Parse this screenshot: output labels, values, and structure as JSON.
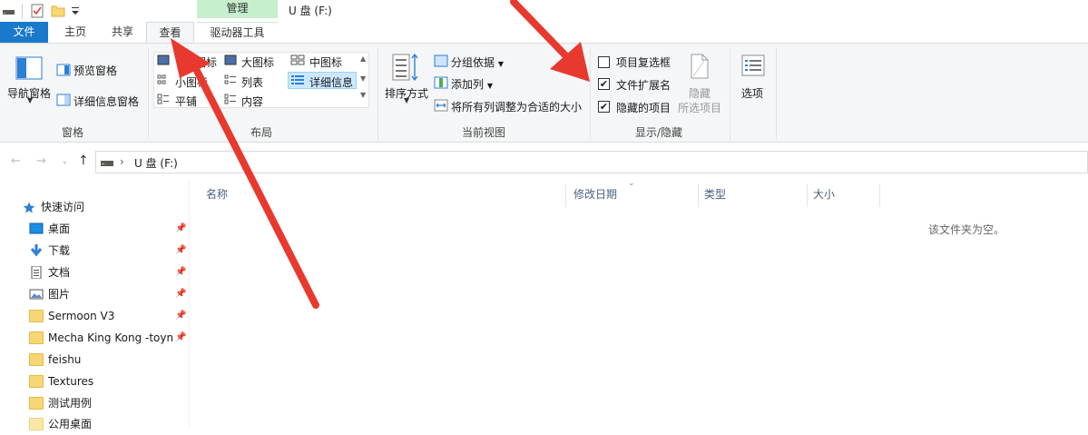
{
  "window": {
    "title": "U 盘 (F:)"
  },
  "context_tab": {
    "header": "管理",
    "tab": "驱动器工具"
  },
  "tabs": {
    "file": "文件",
    "home": "主页",
    "share": "共享",
    "view": "查看"
  },
  "ribbon": {
    "pane": {
      "nav_pane": "导航窗格",
      "preview_pane": "预览窗格",
      "details_pane": "详细信息窗格",
      "group": "窗格"
    },
    "layout": {
      "items": [
        "图标",
        "大图标",
        "中图标",
        "小图标",
        "列表",
        "详细信息",
        "平铺",
        "内容"
      ],
      "group": "布局"
    },
    "current_view": {
      "sort_by": "排序方式",
      "group_by": "分组依据",
      "add_column": "添加列",
      "size_all_columns": "将所有列调整为合适的大小",
      "group": "当前视图"
    },
    "show_hide": {
      "item_checkboxes": "项目复选框",
      "file_extensions": "文件扩展名",
      "hidden_items": "隐藏的项目",
      "item_checkboxes_checked": false,
      "file_extensions_checked": true,
      "hidden_items_checked": true,
      "hide_selected_1": "隐藏",
      "hide_selected_2": "所选项目",
      "group": "显示/隐藏"
    },
    "options": "选项"
  },
  "address": {
    "path_sep": "›",
    "location": "U 盘 (F:)"
  },
  "nav": {
    "quick_access": "快速访问",
    "items": [
      {
        "label": "桌面",
        "icon": "desktop-icon",
        "pinned": true
      },
      {
        "label": "下载",
        "icon": "download-icon",
        "pinned": true
      },
      {
        "label": "文档",
        "icon": "document-icon",
        "pinned": true
      },
      {
        "label": "图片",
        "icon": "pictures-icon",
        "pinned": true
      },
      {
        "label": "Sermoon V3",
        "icon": "folder-icon",
        "pinned": true
      },
      {
        "label": "Mecha King Kong -toyn",
        "icon": "folder-icon",
        "pinned": true
      },
      {
        "label": "feishu",
        "icon": "folder-icon",
        "pinned": false
      },
      {
        "label": "Textures",
        "icon": "folder-icon",
        "pinned": false
      },
      {
        "label": "测试用例",
        "icon": "folder-icon",
        "pinned": false
      },
      {
        "label": "公用桌面",
        "icon": "folder-icon",
        "pinned": false
      }
    ]
  },
  "columns": {
    "name": "名称",
    "date": "修改日期",
    "type": "类型",
    "size": "大小"
  },
  "empty_message": "该文件夹为空。",
  "colors": {
    "file_tab": "#1979ca",
    "manage_tab": "#c6efce",
    "arrow": "#e8392f"
  }
}
